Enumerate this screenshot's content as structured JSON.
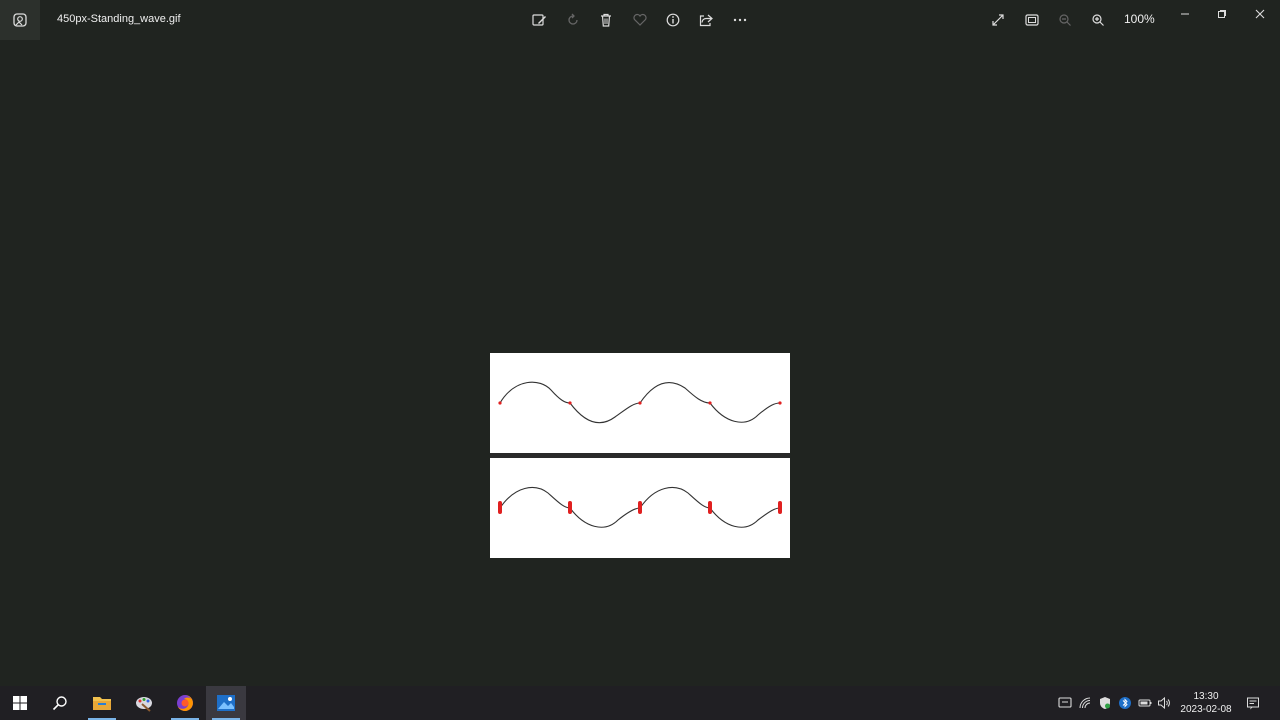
{
  "window": {
    "file_name": "450px-Standing_wave.gif",
    "zoom_level": "100%"
  },
  "toolbar": {
    "icons": [
      "edit-image-icon",
      "rotate-icon",
      "delete-icon",
      "favorite-icon",
      "info-icon",
      "share-icon",
      "more-icon"
    ],
    "right_icons": [
      "fullscreen-icon",
      "fit-window-icon",
      "zoom-out-icon",
      "zoom-in-icon"
    ]
  },
  "taskbar": {
    "apps": [
      "start-icon",
      "search-icon",
      "file-explorer-icon",
      "paint-icon",
      "firefox-icon",
      "photos-icon"
    ],
    "clock_time": "13:30",
    "clock_date": "2023-02-08"
  },
  "image": {
    "accent": "#e02020",
    "wave_color": "#333333"
  }
}
